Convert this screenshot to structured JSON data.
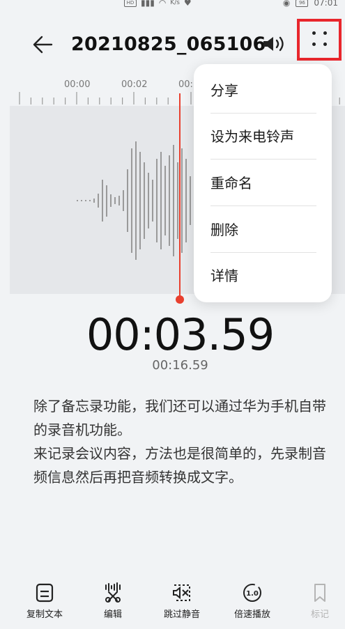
{
  "status_bar": {
    "left_text": "K/s",
    "hd": "HD",
    "battery": "96",
    "time": "07:01"
  },
  "header": {
    "title": "20210825_065106"
  },
  "timeline": {
    "ticks": [
      "00:00",
      "00:02",
      "00:"
    ]
  },
  "menu": {
    "items": [
      "分享",
      "设为来电铃声",
      "重命名",
      "删除",
      "详情"
    ]
  },
  "player": {
    "elapsed": "00:03.59",
    "total": "00:16.59"
  },
  "transcript": {
    "lines": [
      "除了备忘录功能，我们还可以通过华为手机自带的录音机功能。",
      "来记录会议内容，方法也是很简单的，先录制音频信息然后再把音频转换成文字。"
    ]
  },
  "toolbar": {
    "items": [
      "复制文本",
      "编辑",
      "跳过静音",
      "倍速播放",
      "标记"
    ],
    "speed_icon_text": "1.0"
  },
  "colors": {
    "accent": "#e8402f",
    "highlight_box": "#e8262c",
    "background": "#f1f3f5",
    "wave_bg": "#e5e7ea",
    "wave": "#9a9a9a"
  }
}
